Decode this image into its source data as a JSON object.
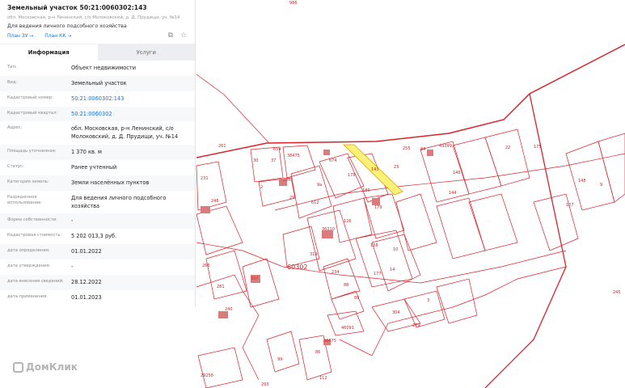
{
  "header": {
    "title": "Земельный участок 50:21:0060302:143",
    "address": "обл. Московская, р-н Ленинский, с/о Молоковский, д. Д. Прудищи, уч. №14",
    "use": "Для ведения личного подсобного хозяйства",
    "link_zu": "План ЗУ →",
    "link_kk": "План КК →",
    "icons": [
      "search-document-icon",
      "star-icon"
    ]
  },
  "tabs": [
    {
      "label": "Информация",
      "active": true
    },
    {
      "label": "Услуги",
      "active": false
    }
  ],
  "rows": [
    {
      "label": "Тип:",
      "value": "Объект недвижимости"
    },
    {
      "label": "Вид:",
      "value": "Земельный участок"
    },
    {
      "label": "Кадастровый номер:",
      "value": "50:21:0060302:143",
      "link": true
    },
    {
      "label": "Кадастровый квартал:",
      "value": "50:21:0060302",
      "link": true
    },
    {
      "label": "Адрес:",
      "value": "обл. Московская, р-н Ленинский, с/о Молоковский, д. Д. Прудищи, уч. №14"
    },
    {
      "label": "Площадь уточненная:",
      "value": "1 370 кв. м"
    },
    {
      "label": "Статус:",
      "value": "Ранее учтенный"
    },
    {
      "label": "Категория земель:",
      "value": "Земли населённых пунктов"
    },
    {
      "label": "Разрешенное использование:",
      "value": "Для ведения личного подсобного хозяйства"
    },
    {
      "label": "Форма собственности:",
      "value": "-"
    },
    {
      "label": "Кадастровая стоимость:",
      "value": "5 202 013,3 руб."
    },
    {
      "label": "дата определения:",
      "value": "01.01.2022"
    },
    {
      "label": "дата утверждения:",
      "value": "-"
    },
    {
      "label": "дата внесения сведений:",
      "value": "28.12.2022"
    },
    {
      "label": "дата применения:",
      "value": "01.01.2023"
    }
  ],
  "map": {
    "colors": {
      "line": "#d8232a",
      "selected": "#fff176"
    },
    "labels": [
      "986",
      "261",
      "654",
      "38475",
      "37",
      "30",
      "2",
      "286",
      "29",
      "612",
      "9а",
      "674",
      "178",
      "180",
      "179",
      "143",
      "23",
      "255",
      "84",
      "43399",
      "22",
      "175",
      "231",
      "246",
      "36210",
      "319",
      "126",
      "10",
      "14",
      "138",
      "60302",
      "337",
      "281",
      "266",
      "240",
      "234",
      "88",
      "89",
      "177",
      "304",
      "3",
      "279",
      "46091",
      "38675",
      "86",
      "99",
      "112",
      "29258",
      "293",
      "245",
      "127",
      "148",
      "9",
      "144",
      "146"
    ]
  },
  "watermark": "ДомКлик"
}
